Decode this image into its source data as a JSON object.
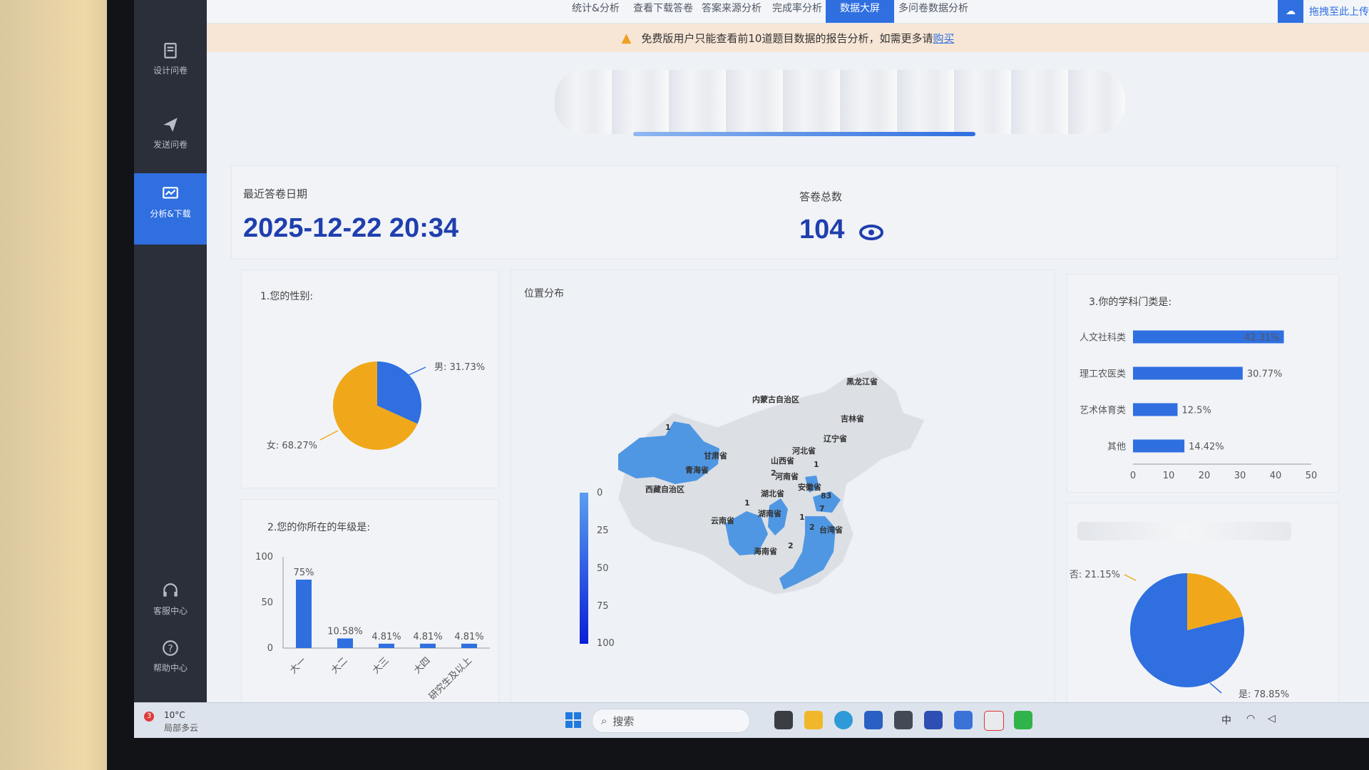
{
  "sidebar": {
    "items": [
      {
        "label": "设计问卷"
      },
      {
        "label": "发送问卷"
      },
      {
        "label": "分析&下载"
      },
      {
        "label": "客服中心"
      },
      {
        "label": "帮助中心"
      }
    ]
  },
  "topnav": {
    "tabs": [
      "统计&分析",
      "查看下载答卷",
      "答案来源分析",
      "完成率分析",
      "数据大屏",
      "多问卷数据分析"
    ],
    "active_tab": "数据大屏",
    "upload_label": "拖拽至此上传"
  },
  "notice": {
    "text": "免费版用户只能查看前10道题目数据的报告分析，如需更多请",
    "link": "购买"
  },
  "stats": {
    "last_date_label": "最近答卷日期",
    "last_date_value": "2025-12-22 20:34",
    "total_label": "答卷总数",
    "total_value": "104"
  },
  "gender_chart": {
    "title": "1.您的性别:",
    "chart_data": {
      "type": "pie",
      "slices": [
        {
          "label": "男",
          "value": 31.73,
          "color": "#2f6fe0"
        },
        {
          "label": "女",
          "value": 68.27,
          "color": "#f0a81a"
        }
      ],
      "labels": [
        "男: 31.73%",
        "女: 68.27%"
      ]
    }
  },
  "grade_chart": {
    "title": "2.您的你所在的年级是:",
    "chart_data": {
      "type": "bar",
      "categories": [
        "大一",
        "大二",
        "大三",
        "大四",
        "研究生及以上"
      ],
      "values": [
        75,
        10.58,
        4.81,
        4.81,
        4.81
      ],
      "data_labels": [
        "75%",
        "10.58%",
        "4.81%",
        "4.81%",
        "4.81%"
      ],
      "ylim": [
        0,
        100
      ],
      "yticks": [
        "100",
        "50",
        "0"
      ],
      "color": "#2f6fe0"
    }
  },
  "map_chart": {
    "title": "位置分布",
    "legend_ticks": [
      "0",
      "25",
      "50",
      "75",
      "100"
    ],
    "province_labels": [
      {
        "name": "黑龙江省"
      },
      {
        "name": "内蒙古自治区"
      },
      {
        "name": "吉林省"
      },
      {
        "name": "辽宁省"
      },
      {
        "name": "河北省"
      },
      {
        "name": "山西省"
      },
      {
        "name": "甘肃省"
      },
      {
        "name": "青海省"
      },
      {
        "name": "河南省"
      },
      {
        "name": "安徽省"
      },
      {
        "name": "湖北省"
      },
      {
        "name": "西藏自治区"
      },
      {
        "name": "湖南省"
      },
      {
        "name": "云南省"
      },
      {
        "name": "台湾省"
      },
      {
        "name": "海南省"
      }
    ],
    "counts": [
      {
        "value": "1"
      },
      {
        "value": "2"
      },
      {
        "value": "1"
      },
      {
        "value": "1"
      },
      {
        "value": "83"
      },
      {
        "value": "7"
      },
      {
        "value": "1"
      },
      {
        "value": "2"
      },
      {
        "value": "2"
      }
    ]
  },
  "subject_chart": {
    "title": "3.你的学科门类是:",
    "chart_data": {
      "type": "bar",
      "orientation": "horizontal",
      "categories": [
        "人文社科类",
        "理工农医类",
        "艺术体育类",
        "其他"
      ],
      "values": [
        42.31,
        30.77,
        12.5,
        14.42
      ],
      "data_labels": [
        "42.31%",
        "30.77%",
        "12.5%",
        "14.42%"
      ],
      "xlim": [
        0,
        50
      ],
      "xticks": [
        "0",
        "10",
        "20",
        "30",
        "40",
        "50"
      ],
      "color": "#2f6fe0"
    }
  },
  "yesno_chart": {
    "chart_data": {
      "type": "pie",
      "slices": [
        {
          "label": "否",
          "value": 21.15,
          "color": "#f0a81a"
        },
        {
          "label": "是",
          "value": 78.85,
          "color": "#2f6fe0"
        }
      ],
      "labels": [
        "否: 21.15%",
        "是: 78.85%"
      ]
    }
  },
  "taskbar": {
    "weather_temp": "10°C",
    "weather_desc": "局部多云",
    "weather_badge": "3",
    "search_placeholder": "搜索",
    "ime": "中"
  }
}
